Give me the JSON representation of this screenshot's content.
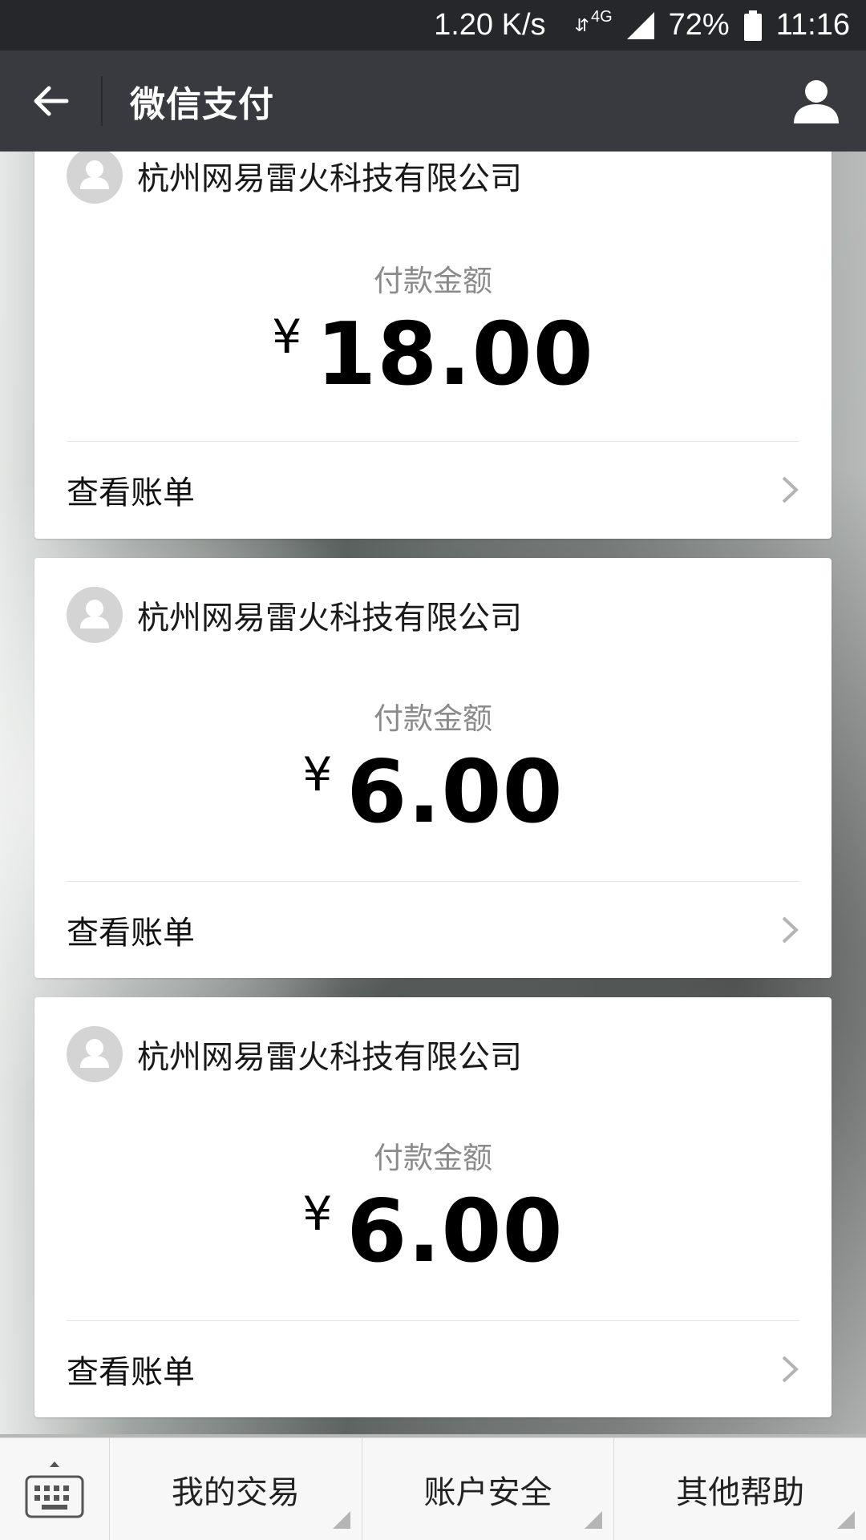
{
  "status_bar": {
    "net_speed": "1.20 K/s",
    "network_type": "4G",
    "battery": "72%",
    "time": "11:16"
  },
  "app_bar": {
    "title": "微信支付"
  },
  "cards": [
    {
      "merchant": "杭州网易雷火科技有限公司",
      "amount_label": "付款金额",
      "currency": "¥",
      "amount": "18.00",
      "action": "查看账单"
    },
    {
      "merchant": "杭州网易雷火科技有限公司",
      "amount_label": "付款金额",
      "currency": "¥",
      "amount": "6.00",
      "action": "查看账单"
    },
    {
      "merchant": "杭州网易雷火科技有限公司",
      "amount_label": "付款金额",
      "currency": "¥",
      "amount": "6.00",
      "action": "查看账单"
    }
  ],
  "bottom_menu": {
    "items": [
      "我的交易",
      "账户安全",
      "其他帮助"
    ]
  },
  "icons": {
    "back": "arrow-left-icon",
    "profile": "person-icon",
    "avatar": "default-avatar-icon",
    "chevron": "chevron-right-icon",
    "keyboard": "keyboard-icon"
  },
  "colors": {
    "status_bar_bg": "#26272b",
    "app_bar_bg": "#393a3f",
    "card_bg": "#ffffff",
    "label_gray": "#8a8a8a",
    "bottom_bar_bg": "#f7f7f7"
  }
}
